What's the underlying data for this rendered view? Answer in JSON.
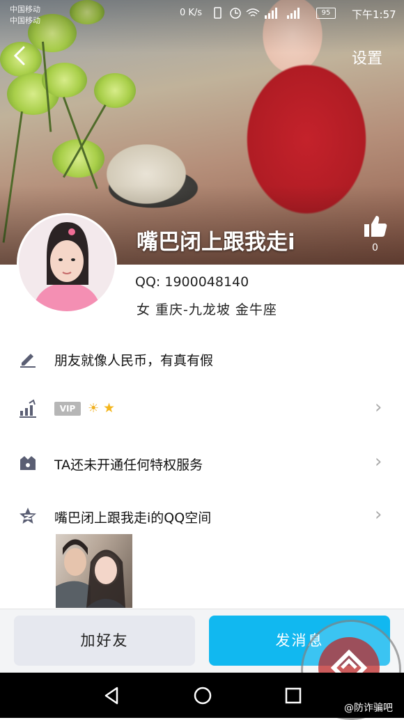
{
  "status_bar": {
    "carrier_1": "中国移动",
    "carrier_2": "中国移动",
    "net_speed": "0 K/s",
    "battery": "95",
    "time": "下午1:57"
  },
  "header": {
    "back_icon": "chevron-left-icon",
    "settings_label": "设置"
  },
  "profile": {
    "nickname": "嘴巴闭上跟我走i",
    "likes": "0",
    "qq_line": "QQ: 1900048140",
    "detail_line": "女  重庆-九龙坡  金牛座"
  },
  "rows": {
    "signature": "朋友就像人民币，有真有假",
    "vip_badge": "VIP",
    "privilege": "TA还未开通任何特权服务",
    "qzone": "嘴巴闭上跟我走i的QQ空间"
  },
  "actions": {
    "add_friend": "加好友",
    "send_message": "发消息"
  },
  "watermark": {
    "caption": "@防诈骗吧"
  },
  "colors": {
    "accent": "#11b8f0",
    "secondary_button": "#e6e8ef"
  }
}
